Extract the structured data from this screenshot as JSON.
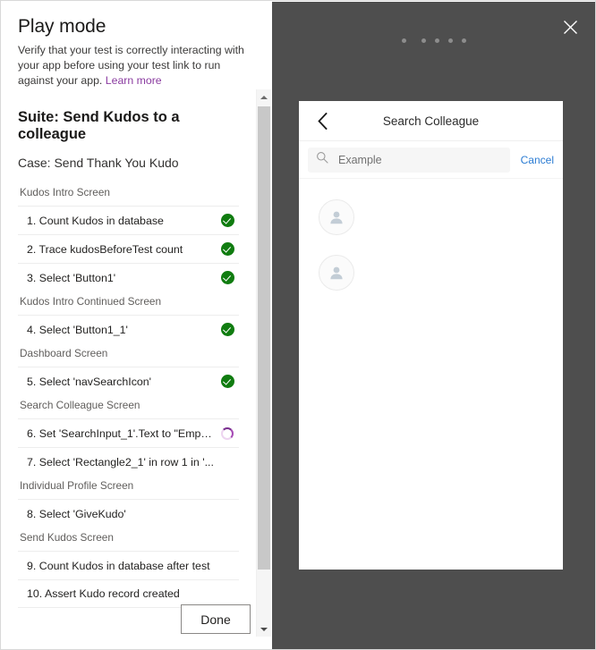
{
  "panel": {
    "title": "Play mode",
    "description": "Verify that your test is correctly interacting with your app before using your test link to run against your app.",
    "learn_more_label": "Learn more",
    "suite_title": "Suite: Send Kudos to a colleague",
    "case_title": "Case: Send Thank You Kudo",
    "done_label": "Done",
    "accent_link_color": "#8a3ba0",
    "pass_color": "#107c10",
    "running_color": "#8a3ba0"
  },
  "groups": [
    {
      "label": "Kudos Intro Screen",
      "steps": [
        {
          "text": "1. Count Kudos in database",
          "status": "passed"
        },
        {
          "text": "2. Trace kudosBeforeTest count",
          "status": "passed"
        },
        {
          "text": "3. Select 'Button1'",
          "status": "passed"
        }
      ]
    },
    {
      "label": "Kudos Intro Continued Screen",
      "steps": [
        {
          "text": "4. Select 'Button1_1'",
          "status": "passed"
        }
      ]
    },
    {
      "label": "Dashboard Screen",
      "steps": [
        {
          "text": "5. Select 'navSearchIcon'",
          "status": "passed"
        }
      ]
    },
    {
      "label": "Search Colleague Screen",
      "steps": [
        {
          "text": "6. Set 'SearchInput_1'.Text to \"Emplo...",
          "status": "running"
        },
        {
          "text": "7. Select 'Rectangle2_1' in row 1 in '...",
          "status": "none"
        }
      ]
    },
    {
      "label": "Individual Profile Screen",
      "steps": [
        {
          "text": "8. Select 'GiveKudo'",
          "status": "none"
        }
      ]
    },
    {
      "label": "Send Kudos Screen",
      "steps": [
        {
          "text": "9. Count Kudos in database after test",
          "status": "none"
        },
        {
          "text": "10. Assert Kudo record created",
          "status": "none"
        }
      ]
    }
  ],
  "player": {
    "background_color": "#4e4e4e",
    "close_icon": "close-icon",
    "dots_count": 5,
    "phone": {
      "back_icon": "chevron-left-icon",
      "title": "Search Colleague",
      "search": {
        "icon": "search-icon",
        "placeholder": "Example",
        "value": "",
        "cancel_label": "Cancel",
        "cancel_color": "#2b7cd3"
      },
      "results": [
        {
          "avatar_icon": "person-icon"
        },
        {
          "avatar_icon": "person-icon"
        }
      ]
    }
  }
}
